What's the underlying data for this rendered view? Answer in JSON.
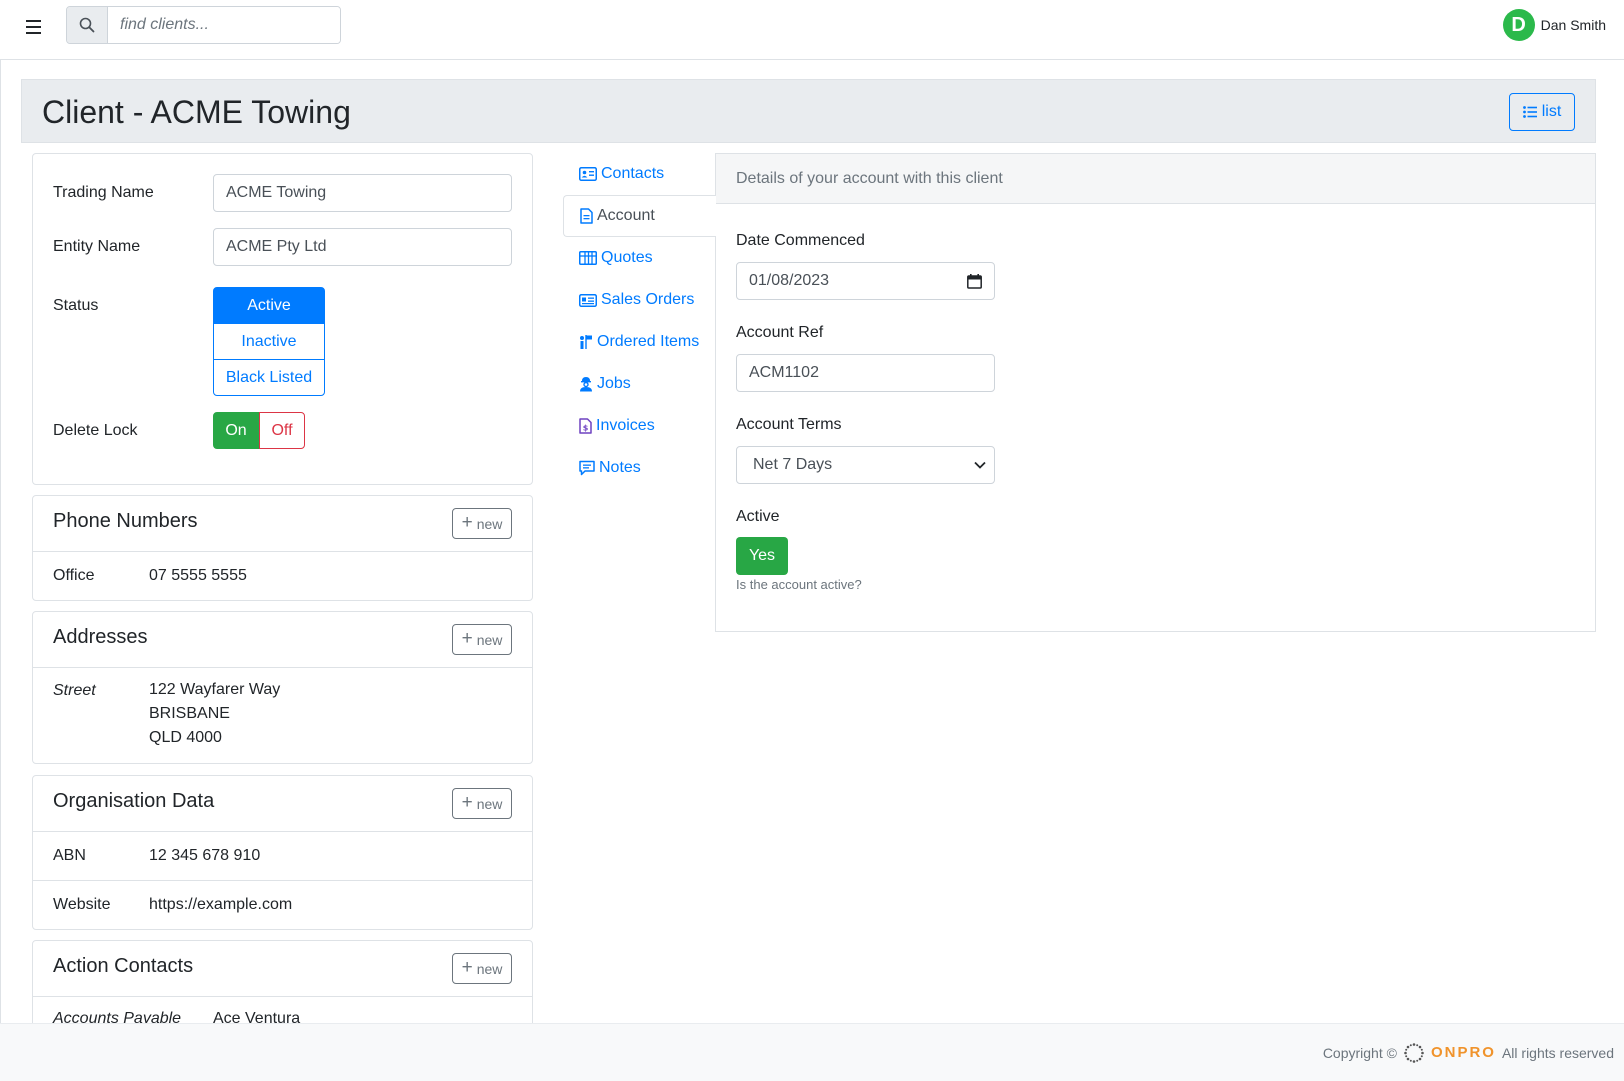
{
  "header": {
    "search_placeholder": "find clients...",
    "user_initial": "D",
    "user_name": "Dan Smith"
  },
  "page": {
    "title": "Client - ACME Towing",
    "list_button": "list"
  },
  "details": {
    "trading_name_label": "Trading Name",
    "trading_name_value": "ACME Towing",
    "entity_name_label": "Entity Name",
    "entity_name_value": "ACME Pty Ltd",
    "status_label": "Status",
    "status_options": [
      "Active",
      "Inactive",
      "Black Listed"
    ],
    "status_selected": "Active",
    "delete_lock_label": "Delete Lock",
    "delete_lock_on": "On",
    "delete_lock_off": "Off",
    "delete_lock_selected": "On"
  },
  "phone_numbers": {
    "title": "Phone Numbers",
    "new_label": "new",
    "rows": [
      {
        "key": "Office",
        "value": "07 5555 5555"
      }
    ]
  },
  "addresses": {
    "title": "Addresses",
    "new_label": "new",
    "type": "Street",
    "lines": [
      "122 Wayfarer Way",
      "BRISBANE",
      "QLD 4000"
    ]
  },
  "organisation_data": {
    "title": "Organisation Data",
    "new_label": "new",
    "rows": [
      {
        "key": "ABN",
        "value": "12 345 678 910"
      },
      {
        "key": "Website",
        "value": "https://example.com"
      }
    ]
  },
  "action_contacts": {
    "title": "Action Contacts",
    "new_label": "new",
    "rows": [
      {
        "key": "Accounts Payable",
        "value": "Ace Ventura"
      }
    ]
  },
  "tabs": [
    {
      "label": "Contacts",
      "icon": "contact-card-icon",
      "color": "#007bff"
    },
    {
      "label": "Account",
      "icon": "document-icon",
      "color": "#495057"
    },
    {
      "label": "Quotes",
      "icon": "calculator-grid-icon",
      "color": "#007bff"
    },
    {
      "label": "Sales Orders",
      "icon": "id-card-icon",
      "color": "#007bff"
    },
    {
      "label": "Ordered Items",
      "icon": "person-flag-icon",
      "color": "#007bff"
    },
    {
      "label": "Jobs",
      "icon": "worker-icon",
      "color": "#007bff"
    },
    {
      "label": "Invoices",
      "icon": "invoice-dollar-icon",
      "color": "#6f42c1"
    },
    {
      "label": "Notes",
      "icon": "comment-icon",
      "color": "#007bff"
    }
  ],
  "active_tab": "Account",
  "account": {
    "heading": "Details of your account with this client",
    "date_label": "Date Commenced",
    "date_value": "01/08/2023",
    "ref_label": "Account Ref",
    "ref_value": "ACM1102",
    "terms_label": "Account Terms",
    "terms_value": "Net 7 Days",
    "active_label": "Active",
    "active_value": "Yes",
    "active_help": "Is the account active?"
  },
  "footer": {
    "copyright": "Copyright ©",
    "brand": "ONPRO",
    "rights": "All rights reserved"
  },
  "colors": {
    "primary": "#007bff",
    "success": "#28a745",
    "danger": "#dc3545",
    "brand": "#f0932b",
    "avatar": "#2bb94b"
  }
}
